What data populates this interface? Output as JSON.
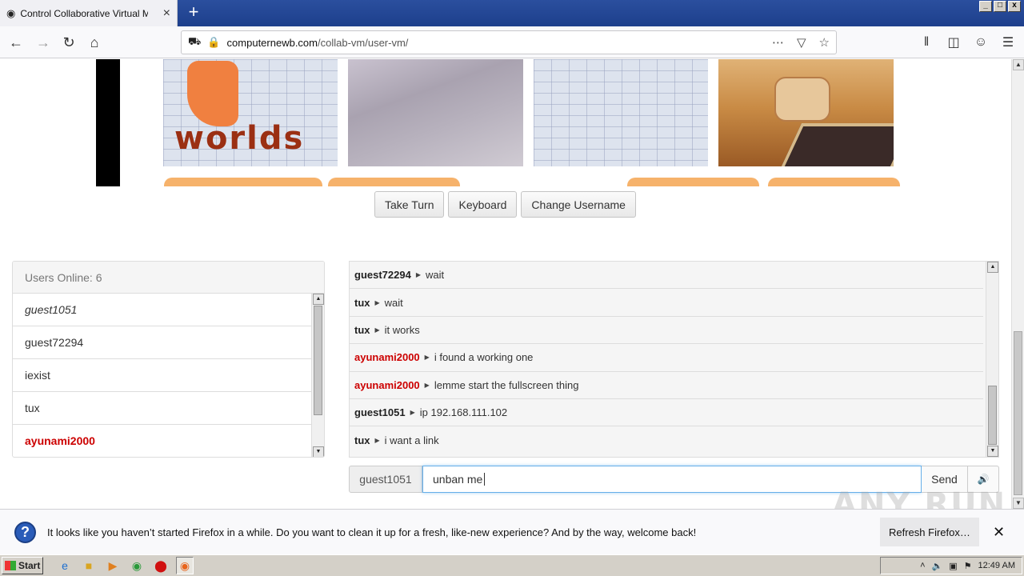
{
  "browser": {
    "tab_title": "Control Collaborative Virtual Machi",
    "url_domain": "computernewb.com",
    "url_path": "/collab-vm/user-vm/"
  },
  "vm_screen": {
    "logo_text": "worlds"
  },
  "controls": {
    "take_turn": "Take Turn",
    "keyboard": "Keyboard",
    "change_username": "Change Username"
  },
  "users_panel": {
    "heading": "Users Online: 6",
    "users": [
      {
        "name": "guest1051",
        "style": "self"
      },
      {
        "name": "guest72294",
        "style": "normal"
      },
      {
        "name": "iexist",
        "style": "normal"
      },
      {
        "name": "tux",
        "style": "normal"
      },
      {
        "name": "ayunami2000",
        "style": "admin"
      }
    ]
  },
  "chat": {
    "messages": [
      {
        "user": "guest72294",
        "text": "wait",
        "admin": false
      },
      {
        "user": "tux",
        "text": "wait",
        "admin": false
      },
      {
        "user": "tux",
        "text": "it works",
        "admin": false
      },
      {
        "user": "ayunami2000",
        "text": "i found a working one",
        "admin": true
      },
      {
        "user": "ayunami2000",
        "text": "lemme start the fullscreen thing",
        "admin": true
      },
      {
        "user": "guest1051",
        "text": "ip 192.168.111.102",
        "admin": false
      },
      {
        "user": "tux",
        "text": "i want a link",
        "admin": false
      }
    ],
    "username": "guest1051",
    "input_value": "unban me",
    "send_label": "Send"
  },
  "notification": {
    "text": "It looks like you haven’t started Firefox in a while. Do you want to clean it up for a fresh, like-new experience? And by the way, welcome back!",
    "refresh_label": "Refresh Firefox…"
  },
  "taskbar": {
    "start_label": "Start",
    "clock": "12:49 AM"
  },
  "watermark": "ANY RUN",
  "colors": {
    "admin_red": "#cc0000",
    "titlebar_blue": "#1d3f8c"
  }
}
